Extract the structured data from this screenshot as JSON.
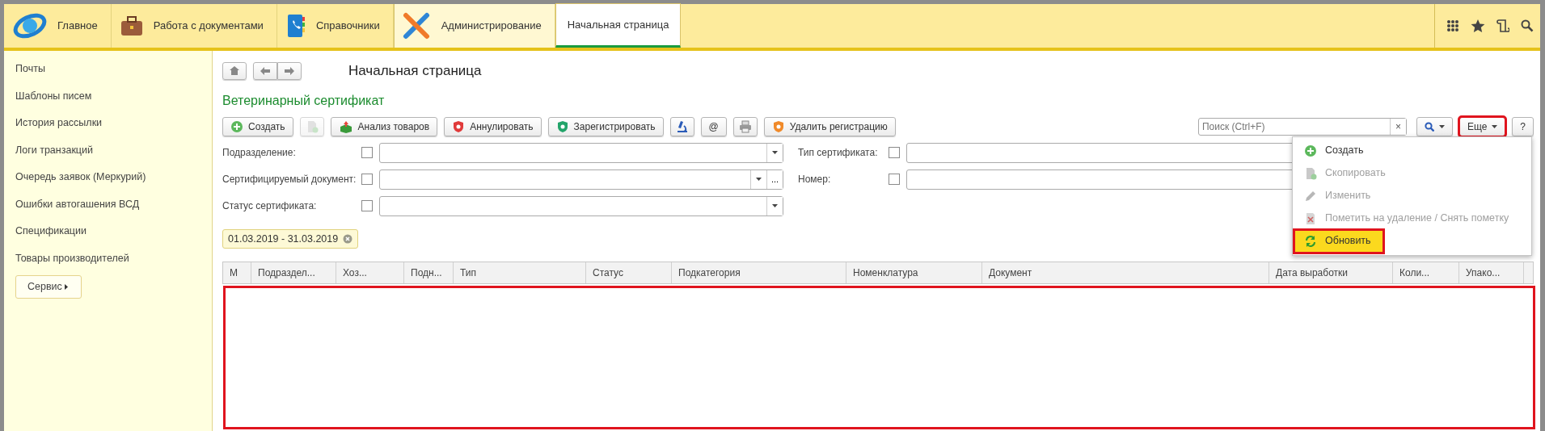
{
  "sections": [
    {
      "label": "Главное",
      "kind": "home",
      "selected": false
    },
    {
      "label": "Работа с документами",
      "kind": "documents",
      "selected": false
    },
    {
      "label": "Справочники",
      "kind": "catalogs",
      "selected": false
    },
    {
      "label": "Администрирование",
      "kind": "admin",
      "selected": true
    }
  ],
  "open_tabs": [
    {
      "label": "Начальная страница",
      "selected": true
    }
  ],
  "sidebar": {
    "items": [
      "Почты",
      "Шаблоны писем",
      "История рассылки",
      "Логи транзакций",
      "Очередь заявок (Меркурий)",
      "Ошибки автогашения ВСД",
      "Спецификации",
      "Товары производителей"
    ],
    "service_button": "Сервис"
  },
  "page": {
    "title": "Начальная страница"
  },
  "form": {
    "title": "Ветеринарный сертификат",
    "toolbar": [
      {
        "kind": "create",
        "label": "Создать",
        "disabled": false
      },
      {
        "kind": "copy",
        "disabled": true
      },
      {
        "kind": "analysis",
        "label": "Анализ товаров",
        "disabled": false
      },
      {
        "kind": "annul",
        "label": "Аннулировать",
        "disabled": false
      },
      {
        "kind": "register",
        "label": "Зарегистрировать",
        "disabled": false
      },
      {
        "kind": "lab",
        "disabled": false
      },
      {
        "kind": "email",
        "label": "@",
        "disabled": false
      },
      {
        "kind": "print",
        "disabled": false
      },
      {
        "kind": "unregister",
        "label": "Удалить регистрацию",
        "disabled": false
      }
    ],
    "search": {
      "placeholder": "Поиск (Ctrl+F)",
      "clear": "×"
    },
    "more_button": {
      "label": "Еще",
      "highlighted": true
    },
    "help_button": "?",
    "filters_left": [
      {
        "label": "Подразделение:",
        "checked": false
      },
      {
        "label": "Сертифицируемый документ:",
        "checked": false,
        "choice_button": "..."
      },
      {
        "label": "Статус сертификата:",
        "checked": false
      }
    ],
    "filters_right": [
      {
        "label": "Тип сертификата:",
        "checked": false
      },
      {
        "label": "Номер:",
        "checked": false
      }
    ],
    "period": "01.03.2019 - 31.03.2019",
    "table": {
      "columns": [
        "М",
        "Подраздел...",
        "Хоз...",
        "Подн...",
        "Тип",
        "Статус",
        "Подкатегория",
        "Номенклатура",
        "Документ",
        "Дата выработки",
        "Коли...",
        "Упако..."
      ],
      "body_highlighted": true
    },
    "more_menu": [
      {
        "label": "Создать",
        "kind": "create",
        "disabled": false,
        "selected": false,
        "highlighted": false
      },
      {
        "label": "Скопировать",
        "kind": "copy",
        "disabled": true,
        "selected": false,
        "highlighted": false
      },
      {
        "label": "Изменить",
        "kind": "edit",
        "disabled": true,
        "selected": false,
        "highlighted": false
      },
      {
        "label": "Пометить на удаление / Снять пометку",
        "kind": "delete",
        "disabled": true,
        "selected": false,
        "highlighted": false
      },
      {
        "label": "Обновить",
        "kind": "refresh",
        "disabled": false,
        "selected": true,
        "highlighted": true
      }
    ]
  }
}
